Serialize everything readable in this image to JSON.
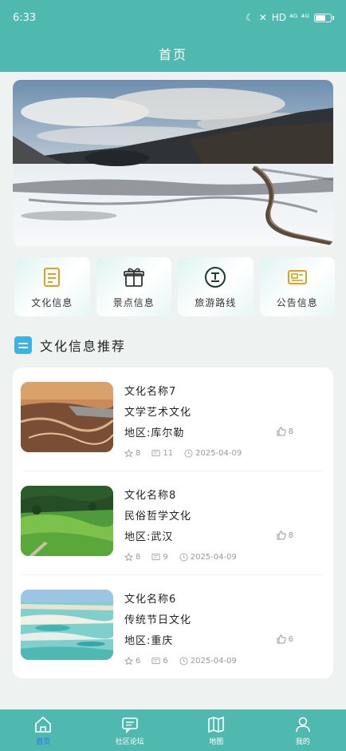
{
  "status": {
    "time": "6:33",
    "right_text": "HD ⁴ᴳ ⁴ᴳ"
  },
  "header": {
    "title": "首页"
  },
  "quick": [
    {
      "label": "文化信息"
    },
    {
      "label": "景点信息"
    },
    {
      "label": "旅游路线"
    },
    {
      "label": "公告信息"
    }
  ],
  "section": {
    "title": "文化信息推荐"
  },
  "items": [
    {
      "name": "文化名称7",
      "type": "文学艺术文化",
      "region": "地区:库尔勒",
      "likes": "8",
      "favorites": "8",
      "comments": "11",
      "date": "2025-04-09"
    },
    {
      "name": "文化名称8",
      "type": "民俗哲学文化",
      "region": "地区:武汉",
      "likes": "8",
      "favorites": "8",
      "comments": "9",
      "date": "2025-04-09"
    },
    {
      "name": "文化名称6",
      "type": "传统节日文化",
      "region": "地区:重庆",
      "likes": "6",
      "favorites": "6",
      "comments": "6",
      "date": "2025-04-09"
    }
  ],
  "tabs": [
    {
      "label": "首页"
    },
    {
      "label": "社区论坛"
    },
    {
      "label": "地图"
    },
    {
      "label": "我的"
    }
  ],
  "colors": {
    "primary": "#4fb9b0",
    "active_tab_label": "#2a6ff3",
    "section_icon": "#3bb2e8"
  }
}
